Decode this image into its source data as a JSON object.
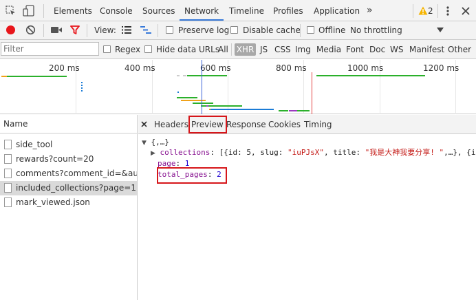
{
  "main_tabs": [
    "Elements",
    "Console",
    "Sources",
    "Network",
    "Timeline",
    "Profiles",
    "Application"
  ],
  "main_active_tab": "Network",
  "more_tabs_glyph": "»",
  "warning_count": "2",
  "toolbar": {
    "view_label": "View:",
    "preserve_log": "Preserve log",
    "disable_cache": "Disable cache",
    "offline": "Offline",
    "throttling": "No throttling"
  },
  "filter": {
    "placeholder": "Filter",
    "regex": "Regex",
    "hide_data_urls": "Hide data URLs",
    "types": [
      "All",
      "XHR",
      "JS",
      "CSS",
      "Img",
      "Media",
      "Font",
      "Doc",
      "WS",
      "Manifest",
      "Other"
    ],
    "active_type": "XHR"
  },
  "overview": {
    "ticks": [
      "200 ms",
      "400 ms",
      "600 ms",
      "800 ms",
      "1000 ms",
      "1200 ms"
    ]
  },
  "requests": {
    "header": "Name",
    "items": [
      "side_tool",
      "rewards?count=20",
      "comments?comment_id=&aut...",
      "included_collections?page=1",
      "mark_viewed.json"
    ],
    "selected_index": 3
  },
  "detail": {
    "tabs": [
      "Headers",
      "Preview",
      "Response",
      "Cookies",
      "Timing"
    ],
    "active_tab": "Preview",
    "preview": {
      "root": "{,…}",
      "collections_key": "collections",
      "collections_value_1": "[{id: 5, slug: ",
      "collections_slug": "\"iuPJsX\"",
      "collections_value_2": ", title: ",
      "collections_title": "\"我是大神我要分享! \"",
      "collections_value_3": ",…}, {i",
      "page_key": "page",
      "page_value": "1",
      "total_pages_key": "total_pages",
      "total_pages_value": "2"
    }
  },
  "colors": {
    "record_red": "#e8161b",
    "filter_red": "#e8161b",
    "accent_blue": "#3879d9",
    "highlight_red": "#d6161a",
    "bar_green": "#2bb02b",
    "bar_blue": "#1a7bd6",
    "bar_purple": "#9c3bbf",
    "bar_orange": "#f0a21a"
  }
}
